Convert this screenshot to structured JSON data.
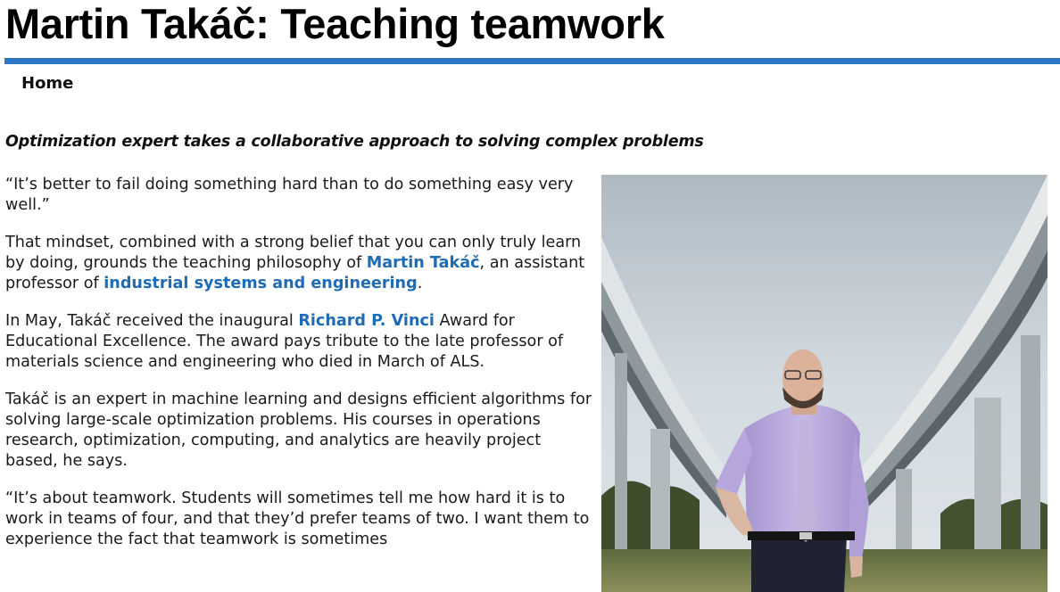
{
  "header": {
    "title": "Martin Takáč: Teaching teamwork"
  },
  "nav": {
    "home_label": "Home"
  },
  "article": {
    "subhead": "Optimization expert takes a collaborative approach to solving complex problems",
    "p1": "“It’s better to fail doing something hard than to do something easy very well.”",
    "p2_a": "That mindset, combined with a strong belief that you can only truly learn by doing, grounds the teaching philosophy of ",
    "p2_link1": "Martin Takáč",
    "p2_b": ", an assistant professor of ",
    "p2_link2": "industrial systems and engineering",
    "p2_c": ".",
    "p3_a": "In May, Takáč received the inaugural ",
    "p3_link": "Richard P. Vinci",
    "p3_b": " Award for Educational Excellence. The award pays tribute to the late professor of materials science and engineering who died in March of ALS.",
    "p4": "Takáč is an expert in machine learning and designs efficient algorithms for solving large-scale optimization problems. His courses in operations research, optimization, computing, and analytics are heavily project based, he says.",
    "p5": "“It’s about teamwork. Students will sometimes tell me how hard it is to work in teams of four, and that they’d prefer teams of two. I want them to experience the fact that teamwork is sometimes"
  },
  "colors": {
    "accent_rule": "#2a78c6",
    "link": "#1f6cb5"
  }
}
